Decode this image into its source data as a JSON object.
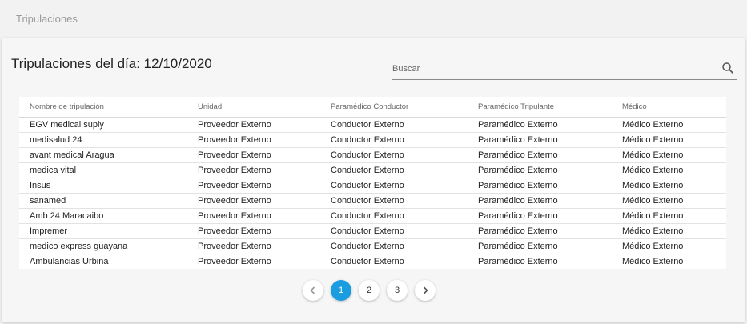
{
  "page": {
    "title": "Tripulaciones"
  },
  "card": {
    "title": "Tripulaciones del día: 12/10/2020"
  },
  "search": {
    "placeholder": "Buscar",
    "icon": "search-icon"
  },
  "table": {
    "headers": [
      "Nombre de tripulación",
      "Unidad",
      "Paramédico Conductor",
      "Paramédico Tripulante",
      "Médico"
    ],
    "rows": [
      [
        "EGV medical suply",
        "Proveedor Externo",
        "Conductor Externo",
        "Paramédico Externo",
        "Médico Externo"
      ],
      [
        "medisalud 24",
        "Proveedor Externo",
        "Conductor Externo",
        "Paramédico Externo",
        "Médico Externo"
      ],
      [
        "avant medical Aragua",
        "Proveedor Externo",
        "Conductor Externo",
        "Paramédico Externo",
        "Médico Externo"
      ],
      [
        "medica vital",
        "Proveedor Externo",
        "Conductor Externo",
        "Paramédico Externo",
        "Médico Externo"
      ],
      [
        "Insus",
        "Proveedor Externo",
        "Conductor Externo",
        "Paramédico Externo",
        "Médico Externo"
      ],
      [
        "sanamed",
        "Proveedor Externo",
        "Conductor Externo",
        "Paramédico Externo",
        "Médico Externo"
      ],
      [
        "Amb 24 Maracaibo",
        "Proveedor Externo",
        "Conductor Externo",
        "Paramédico Externo",
        "Médico Externo"
      ],
      [
        "Impremer",
        "Proveedor Externo",
        "Conductor Externo",
        "Paramédico Externo",
        "Médico Externo"
      ],
      [
        "medico express guayana",
        "Proveedor Externo",
        "Conductor Externo",
        "Paramédico Externo",
        "Médico Externo"
      ],
      [
        "Ambulancias Urbina",
        "Proveedor Externo",
        "Conductor Externo",
        "Paramédico Externo",
        "Médico Externo"
      ]
    ]
  },
  "pagination": {
    "pages": [
      "1",
      "2",
      "3"
    ],
    "active": "1",
    "prev_icon": "chevron-left-icon",
    "next_icon": "chevron-right-icon",
    "active_color": "#1a9ce0"
  }
}
